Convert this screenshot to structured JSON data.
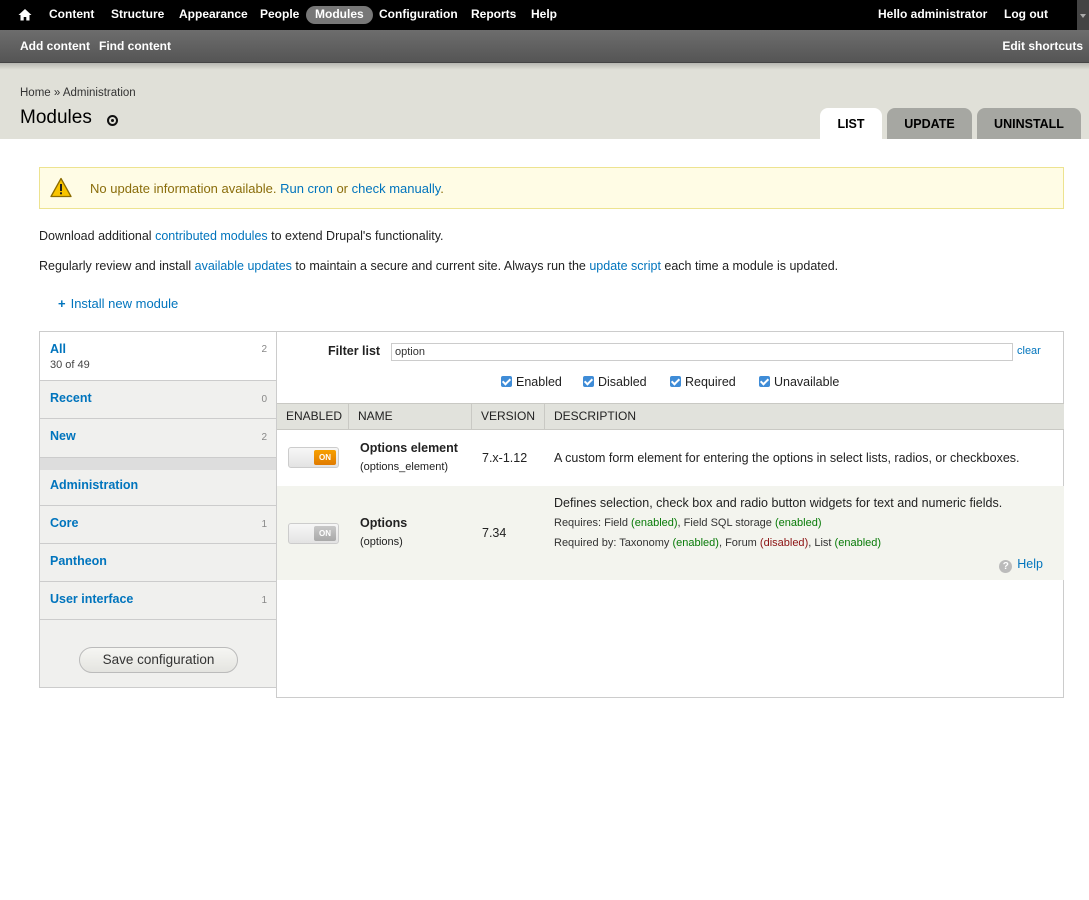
{
  "toolbar": {
    "menu": [
      "Content",
      "Structure",
      "Appearance",
      "People",
      "Modules",
      "Configuration",
      "Reports",
      "Help"
    ],
    "active": "Modules",
    "greeting_prefix": "Hello ",
    "username": "administrator",
    "logout": "Log out"
  },
  "shortcuts": {
    "items": [
      "Add content",
      "Find content"
    ],
    "edit": "Edit shortcuts"
  },
  "header": {
    "breadcrumb": "Home » Administration",
    "title": "Modules",
    "tabs": [
      "LIST",
      "UPDATE",
      "UNINSTALL"
    ],
    "active_tab": "LIST"
  },
  "message": {
    "text": "No update information available.",
    "run_cron": "Run cron",
    "or": "or",
    "check_manually": "check manually",
    "end": "."
  },
  "intro": {
    "line1_pre": "Download additional",
    "line1_link": "contributed modules",
    "line1_post": "to extend Drupal's functionality.",
    "line2_pre": "Regularly review and install",
    "line2_link1": "available updates",
    "line2_mid": "to maintain a secure and current site. Always run the",
    "line2_link2": "update script",
    "line2_post": "each time a module is updated.",
    "install": "Install new module"
  },
  "packages": {
    "all_label": "All",
    "all_count": "2",
    "all_summary": "30 of 49",
    "items": [
      {
        "name": "Recent",
        "count": "0"
      },
      {
        "name": "New",
        "count": "2"
      },
      {
        "name": "Administration",
        "count": ""
      },
      {
        "name": "Core",
        "count": "1"
      },
      {
        "name": "Pantheon",
        "count": ""
      },
      {
        "name": "User interface",
        "count": "1"
      }
    ],
    "save": "Save configuration"
  },
  "filter": {
    "label": "Filter list",
    "value": "option",
    "clear": "clear",
    "checkboxes": [
      "Enabled",
      "Disabled",
      "Required",
      "Unavailable"
    ]
  },
  "table": {
    "headers": [
      "ENABLED",
      "NAME",
      "VERSION",
      "DESCRIPTION"
    ],
    "rows": [
      {
        "state": "ON",
        "name": "Options element",
        "machine": "(options_element)",
        "version": "7.x-1.12",
        "description": "A custom form element for entering the options in select lists, radios, or checkboxes."
      },
      {
        "state": "ON",
        "name": "Options",
        "machine": "(options)",
        "version": "7.34",
        "description": "Defines selection, check box and radio button widgets for text and numeric fields.",
        "requires_label": "Requires:",
        "requires": [
          {
            "name": "Field",
            "status": "enabled"
          },
          {
            "name": "Field SQL storage",
            "status": "enabled"
          }
        ],
        "required_by_label": "Required by:",
        "required_by": [
          {
            "name": "Taxonomy",
            "status": "enabled"
          },
          {
            "name": "Forum",
            "status": "disabled"
          },
          {
            "name": "List",
            "status": "enabled"
          }
        ],
        "help": "Help"
      }
    ]
  }
}
